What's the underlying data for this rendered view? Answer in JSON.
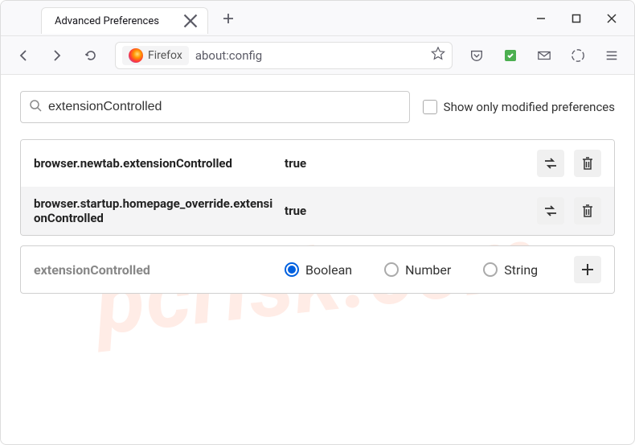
{
  "tab": {
    "title": "Advanced Preferences"
  },
  "address": {
    "label": "Firefox",
    "url": "about:config"
  },
  "search": {
    "value": "extensionControlled",
    "checkbox_label": "Show only modified preferences"
  },
  "prefs": [
    {
      "name": "browser.newtab.extensionControlled",
      "value": "true"
    },
    {
      "name": "browser.startup.homepage_override.extensionControlled",
      "value": "true"
    }
  ],
  "new_pref": {
    "name": "extensionControlled",
    "types": [
      "Boolean",
      "Number",
      "String"
    ],
    "selected": 0
  },
  "watermark": "pcrisk.com"
}
